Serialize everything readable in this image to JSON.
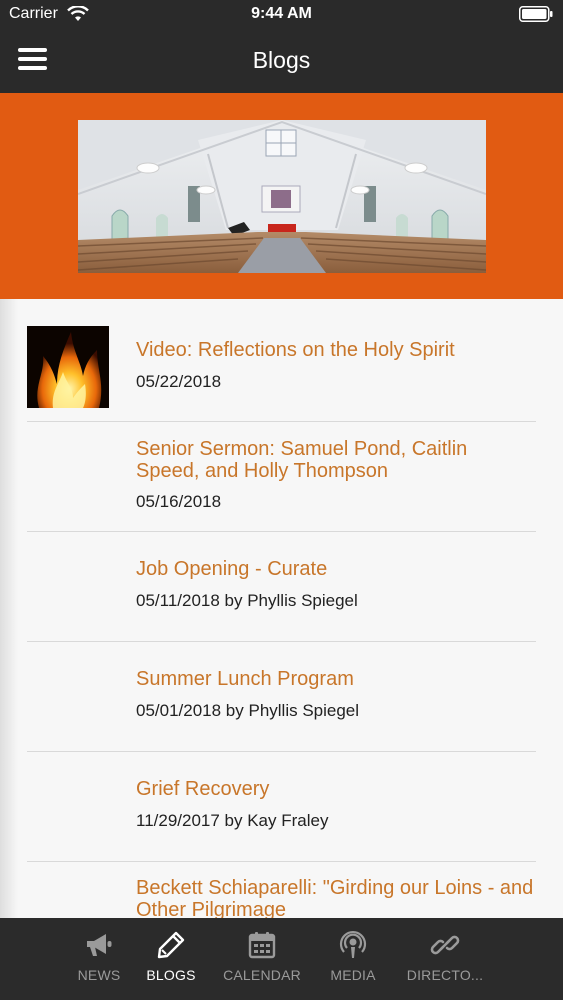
{
  "status_bar": {
    "carrier": "Carrier",
    "time": "9:44 AM"
  },
  "nav": {
    "title": "Blogs",
    "menu_icon": "hamburger-menu-icon"
  },
  "banner": {
    "image": "church-interior-photo"
  },
  "posts": [
    {
      "title": "Video: Reflections on the Holy Spirit",
      "meta": "05/22/2018",
      "thumbnail": "flame-image"
    },
    {
      "title": "Senior Sermon: Samuel Pond, Caitlin Speed, and Holly Thompson",
      "meta": "05/16/2018"
    },
    {
      "title": "Job Opening - Curate",
      "meta": "05/11/2018 by Phyllis Spiegel"
    },
    {
      "title": "Summer Lunch Program",
      "meta": "05/01/2018 by Phyllis Spiegel"
    },
    {
      "title": "Grief Recovery",
      "meta": "11/29/2017 by Kay Fraley"
    },
    {
      "title": "Beckett Schiaparelli: \"Girding our Loins - and Other Pilgrimage",
      "meta": ""
    }
  ],
  "tabs": [
    {
      "label": "NEWS",
      "icon": "megaphone-icon",
      "active": false
    },
    {
      "label": "BLOGS",
      "icon": "pencil-icon",
      "active": true
    },
    {
      "label": "CALENDAR",
      "icon": "calendar-icon",
      "active": false
    },
    {
      "label": "MEDIA",
      "icon": "podcast-icon",
      "active": false
    },
    {
      "label": "DIRECTO...",
      "icon": "link-icon",
      "active": false
    }
  ],
  "colors": {
    "accent_orange": "#e15b12",
    "title_orange": "#c8762a",
    "bar_dark": "#2a2a2a"
  }
}
